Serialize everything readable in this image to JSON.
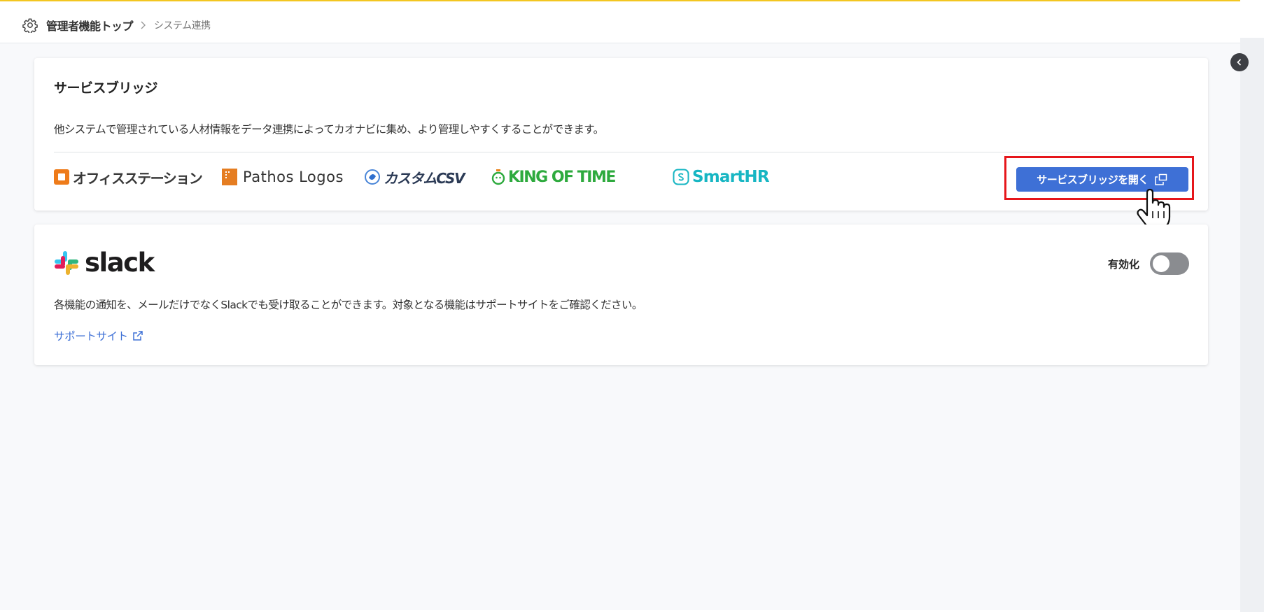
{
  "breadcrumb": {
    "root": "管理者機能トップ",
    "current": "システム連携"
  },
  "service_bridge": {
    "title": "サービスブリッジ",
    "description": "他システムで管理されている人材情報をデータ連携によってカオナビに集め、より管理しやすくすることができます。",
    "logos": [
      {
        "name": "オフィスステーション",
        "icon": "office-station-logo"
      },
      {
        "name": "Pathos Logos",
        "icon": "pathos-logos-logo"
      },
      {
        "name": "カスタムCSV",
        "icon": "custom-csv-logo"
      },
      {
        "name": "KING OF TIME",
        "icon": "king-of-time-logo"
      },
      {
        "name": "SmartHR",
        "icon": "smarthr-logo"
      }
    ],
    "open_button_label": "サービスブリッジを開く"
  },
  "slack": {
    "logo_text": "slack",
    "toggle_label": "有効化",
    "toggle_state": "off",
    "description": "各機能の通知を、メールだけでなくSlackでも受け取ることができます。対象となる機能はサポートサイトをご確認ください。",
    "support_link": "サポートサイト"
  },
  "colors": {
    "accent_blue": "#3e70d6",
    "top_border": "#f3c621",
    "highlight_red": "#e6161b"
  }
}
